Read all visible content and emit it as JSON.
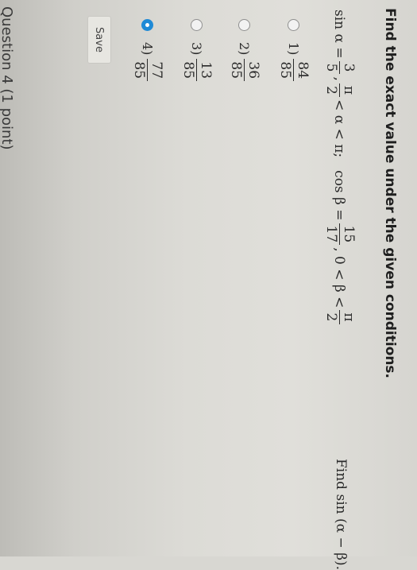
{
  "question": {
    "instruction": "Find the exact value under the given conditions.",
    "given": {
      "sin_label": "sin α =",
      "sin_num": "3",
      "sin_den": "5",
      "sep1": ",",
      "pi_num": "π",
      "pi_den": "2",
      "alpha_range": "< α < π;",
      "cos_label": "cos β =",
      "cos_num": "15",
      "cos_den": "17",
      "beta_range_pre": ", 0 < β <",
      "pi2_num": "π",
      "pi2_den": "2"
    },
    "find": "Find sin (α − β)."
  },
  "options": [
    {
      "label": "1)",
      "num": "84",
      "den": "85",
      "selected": false
    },
    {
      "label": "2)",
      "num": "36",
      "den": "85",
      "selected": false
    },
    {
      "label": "3)",
      "num": "13",
      "den": "85",
      "selected": false
    },
    {
      "label": "4)",
      "num": "77",
      "den": "85",
      "selected": true
    }
  ],
  "actions": {
    "save_label": "Save"
  },
  "next_question": "Question 4 (1 point)"
}
